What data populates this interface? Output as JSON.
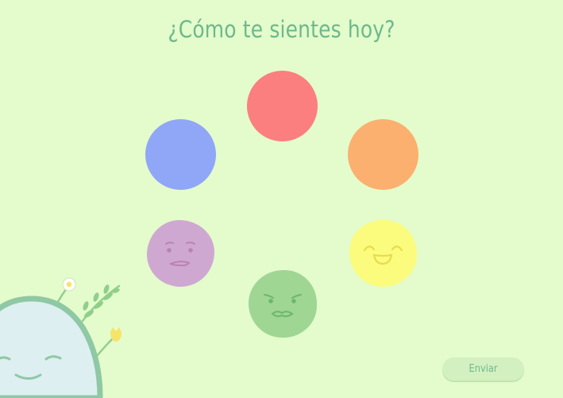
{
  "question": "¿Cómo te sientes hoy?",
  "submit_label": "Enviar",
  "moods": {
    "red": {
      "color": "#fb7f7f",
      "icon": "red-mood-circle"
    },
    "orange": {
      "color": "#fbb06f",
      "icon": "orange-mood-circle"
    },
    "blue": {
      "color": "#90a6f6",
      "icon": "blue-mood-circle"
    },
    "purple": {
      "color": "#cfa8d2",
      "icon": "worried-face-icon"
    },
    "yellow": {
      "color": "#fbfc7e",
      "icon": "happy-face-icon"
    },
    "green": {
      "color": "#9fd694",
      "icon": "annoyed-face-icon"
    }
  },
  "colors": {
    "background": "#e4fbcc",
    "accent_text": "#6cb98c",
    "button": "#d3f0c0"
  }
}
